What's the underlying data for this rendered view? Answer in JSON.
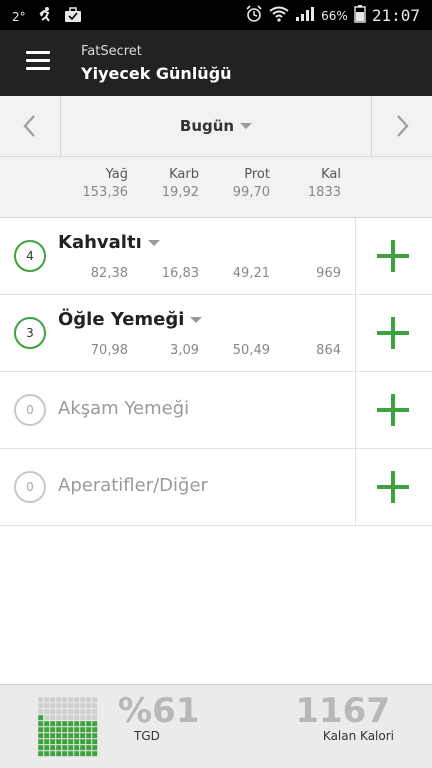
{
  "status_bar": {
    "temperature": "2°",
    "battery": "66%",
    "time": "21:07"
  },
  "app_bar": {
    "app_name": "FatSecret",
    "title": "Yiyecek Günlüğü"
  },
  "date_nav": {
    "label": "Bugün"
  },
  "totals": {
    "headers": {
      "fat": "Yağ",
      "carb": "Karb",
      "prot": "Prot",
      "kal": "Kal"
    },
    "values": {
      "fat": "153,36",
      "carb": "19,92",
      "prot": "99,70",
      "kal": "1833"
    }
  },
  "meals": [
    {
      "count": "4",
      "name": "Kahvaltı",
      "fat": "82,38",
      "carb": "16,83",
      "prot": "49,21",
      "kal": "969"
    },
    {
      "count": "3",
      "name": "Öğle Yemeği",
      "fat": "70,98",
      "carb": "3,09",
      "prot": "50,49",
      "kal": "864"
    },
    {
      "count": "0",
      "name": "Akşam Yemeği"
    },
    {
      "count": "0",
      "name": "Aperatifler/Diğer"
    }
  ],
  "summary": {
    "percent": "%61",
    "percent_label": "TGD",
    "remaining": "1167",
    "remaining_label": "Kalan Kalori",
    "rda_fraction": 0.61
  },
  "colors": {
    "accent_green": "#3ea33e",
    "app_bar": "#222222"
  }
}
